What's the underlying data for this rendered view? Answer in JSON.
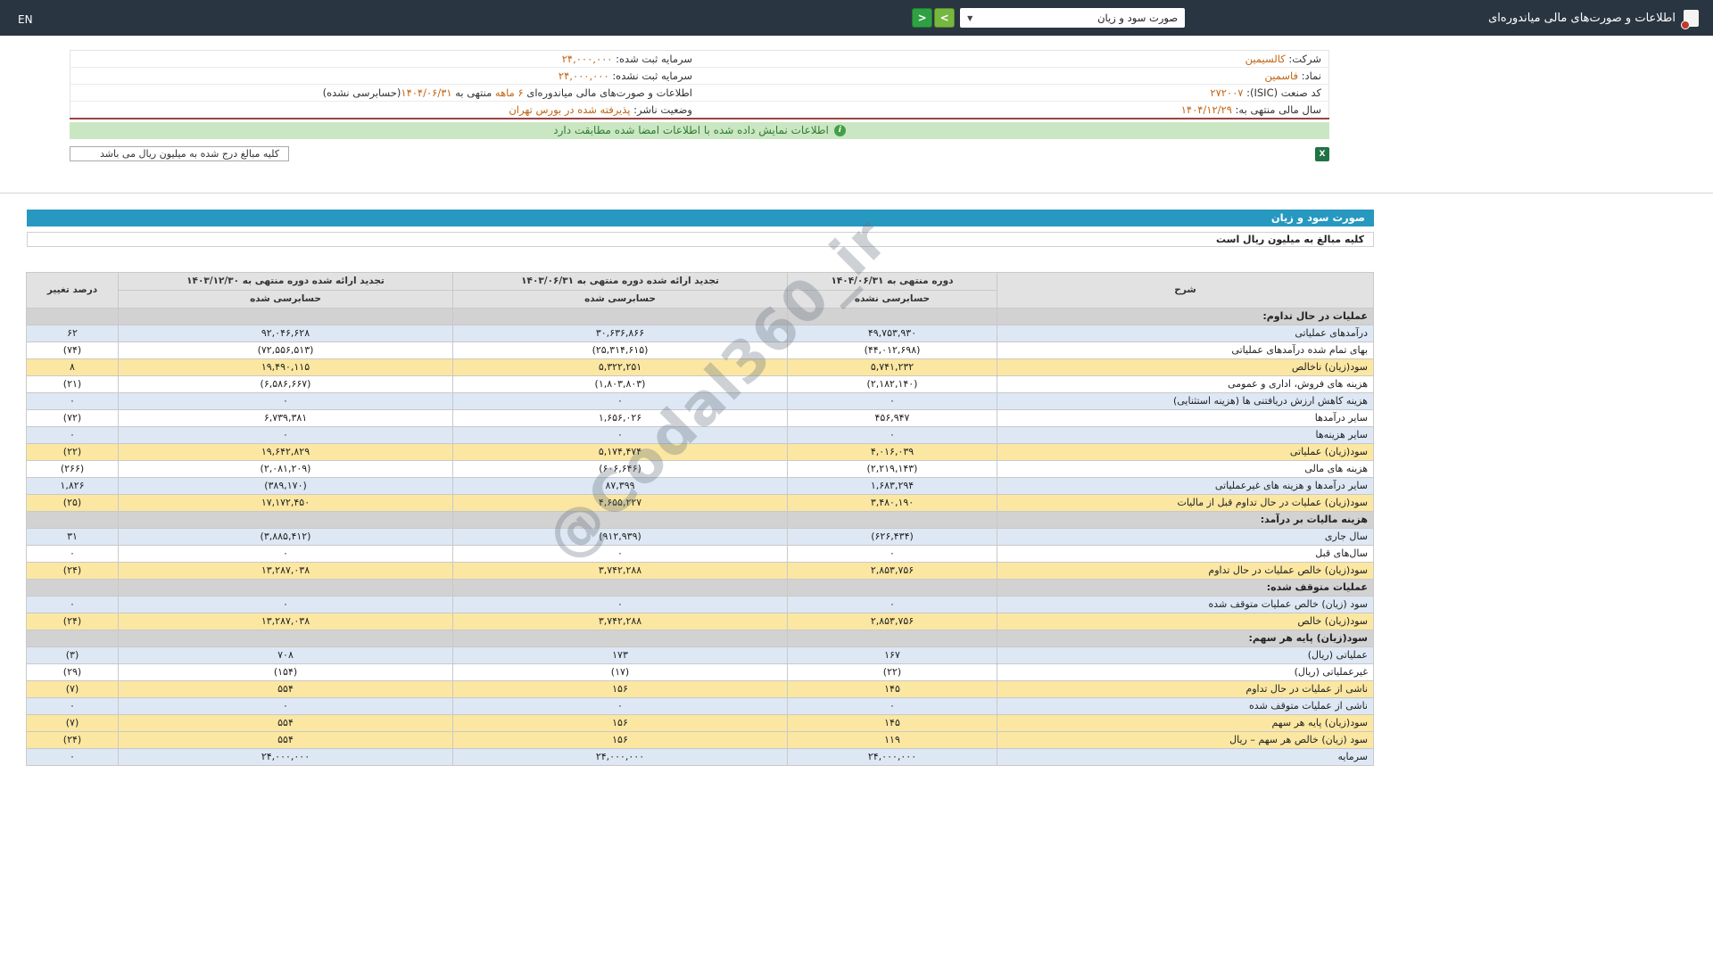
{
  "topbar": {
    "title": "اطلاعات و صورت‌های مالی میاندوره‌ای",
    "dropdown_value": "صورت سود و زیان",
    "prev_label": "<",
    "next_label": ">",
    "lang_toggle": "EN"
  },
  "icons": {
    "caret": "▼",
    "info": "i",
    "excel": "X"
  },
  "company_info": {
    "company_label": "شرکت:",
    "company_value": "کالسیمین",
    "symbol_label": "نماد:",
    "symbol_value": "فاسمین",
    "isic_label": "کد صنعت (ISIC):",
    "isic_value": "۲۷۲۰۰۷",
    "fiscal_year_label": "سال مالی منتهی به:",
    "fiscal_year_value": "۱۴۰۴/۱۲/۲۹",
    "registered_capital_label": "سرمایه ثبت شده:",
    "registered_capital_value": "۲۴,۰۰۰,۰۰۰",
    "unregistered_capital_label": "سرمایه ثبت نشده:",
    "unregistered_capital_value": "۲۴,۰۰۰,۰۰۰",
    "report_line_prefix": "اطلاعات و صورت‌های مالی میاندوره‌ای",
    "report_line_period": "۶ ماهه",
    "report_line_middle": "منتهی به",
    "report_line_date": "۱۴۰۴/۰۶/۳۱",
    "report_line_suffix": "(حسابرسی نشده)",
    "publisher_label": "وضعیت ناشر:",
    "publisher_value": "پذیرفته شده در بورس تهران"
  },
  "notice": "اطلاعات نمایش داده شده با اطلاعات امضا شده مطابقت دارد",
  "amounts_note": "کلیه مبالغ درج شده به میلیون ریال می باشد",
  "watermark": "@Codal360_ir",
  "statement": {
    "title": "صورت سود و زیان",
    "subtitle": "کلیه مبالغ به میلیون ریال است",
    "columns": {
      "desc": "شرح",
      "col1_period": "دوره منتهی به ۱۴۰۴/۰۶/۳۱",
      "col1_audit": "حسابرسی نشده",
      "col2_period": "تجدید ارائه شده دوره منتهی به ۱۴۰۳/۰۶/۳۱",
      "col2_audit": "حسابرسی شده",
      "col3_period": "تجدید ارائه شده دوره منتهی به ۱۴۰۳/۱۲/۳۰",
      "col3_audit": "حسابرسی شده",
      "change": "درصد تغییر"
    },
    "rows": [
      {
        "label": "عملیات در حال تداوم:",
        "v1": "",
        "v2": "",
        "v3": "",
        "change": "",
        "style": "section"
      },
      {
        "label": "درآمدهای عملیاتی",
        "v1": "۴۹,۷۵۳,۹۳۰",
        "v2": "۳۰,۶۳۶,۸۶۶",
        "v3": "۹۲,۰۴۶,۶۲۸",
        "change": "۶۲",
        "style": "blue"
      },
      {
        "label": "بهای تمام شده درآمدهای عملیاتی",
        "v1": "(۴۴,۰۱۲,۶۹۸)",
        "v2": "(۲۵,۳۱۴,۶۱۵)",
        "v3": "(۷۲,۵۵۶,۵۱۳)",
        "change": "(۷۴)",
        "style": "white"
      },
      {
        "label": "سود(زیان) ناخالص",
        "v1": "۵,۷۴۱,۲۳۲",
        "v2": "۵,۳۲۲,۲۵۱",
        "v3": "۱۹,۴۹۰,۱۱۵",
        "change": "۸",
        "style": "yellow"
      },
      {
        "label": "هزینه های فروش، اداری و عمومی",
        "v1": "(۲,۱۸۲,۱۴۰)",
        "v2": "(۱,۸۰۳,۸۰۳)",
        "v3": "(۶,۵۸۶,۶۶۷)",
        "change": "(۲۱)",
        "style": "white"
      },
      {
        "label": "هزینه کاهش ارزش دریافتنی ها (هزینه استثنایی)",
        "v1": "۰",
        "v2": "۰",
        "v3": "۰",
        "change": "۰",
        "style": "blue"
      },
      {
        "label": "سایر درآمدها",
        "v1": "۴۵۶,۹۴۷",
        "v2": "۱,۶۵۶,۰۲۶",
        "v3": "۶,۷۳۹,۳۸۱",
        "change": "(۷۲)",
        "style": "white"
      },
      {
        "label": "سایر هزینه‌ها",
        "v1": "۰",
        "v2": "۰",
        "v3": "۰",
        "change": "۰",
        "style": "blue"
      },
      {
        "label": "سود(زیان) عملیاتی",
        "v1": "۴,۰۱۶,۰۳۹",
        "v2": "۵,۱۷۴,۴۷۴",
        "v3": "۱۹,۶۴۲,۸۲۹",
        "change": "(۲۲)",
        "style": "yellow"
      },
      {
        "label": "هزینه های مالی",
        "v1": "(۲,۲۱۹,۱۴۳)",
        "v2": "(۶۰۶,۶۴۶)",
        "v3": "(۲,۰۸۱,۲۰۹)",
        "change": "(۲۶۶)",
        "style": "white"
      },
      {
        "label": "سایر درآمدها و هزینه های غیرعملیاتی",
        "v1": "۱,۶۸۳,۲۹۴",
        "v2": "۸۷,۳۹۹",
        "v3": "(۳۸۹,۱۷۰)",
        "change": "۱,۸۲۶",
        "style": "blue"
      },
      {
        "label": "سود(زیان) عملیات در حال تداوم قبل از مالیات",
        "v1": "۳,۴۸۰,۱۹۰",
        "v2": "۴,۶۵۵,۲۲۷",
        "v3": "۱۷,۱۷۲,۴۵۰",
        "change": "(۲۵)",
        "style": "yellow"
      },
      {
        "label": "هزینه مالیات بر درآمد:",
        "v1": "",
        "v2": "",
        "v3": "",
        "change": "",
        "style": "section"
      },
      {
        "label": "سال جاری",
        "v1": "(۶۲۶,۴۳۴)",
        "v2": "(۹۱۲,۹۳۹)",
        "v3": "(۳,۸۸۵,۴۱۲)",
        "change": "۳۱",
        "style": "blue"
      },
      {
        "label": "سال‌های قبل",
        "v1": "۰",
        "v2": "۰",
        "v3": "۰",
        "change": "۰",
        "style": "white"
      },
      {
        "label": "سود(زیان) خالص عملیات در حال تداوم",
        "v1": "۲,۸۵۳,۷۵۶",
        "v2": "۳,۷۴۲,۲۸۸",
        "v3": "۱۳,۲۸۷,۰۳۸",
        "change": "(۲۴)",
        "style": "yellow"
      },
      {
        "label": "عملیات متوقف شده:",
        "v1": "",
        "v2": "",
        "v3": "",
        "change": "",
        "style": "section"
      },
      {
        "label": "سود (زیان) خالص عملیات متوقف شده",
        "v1": "۰",
        "v2": "۰",
        "v3": "۰",
        "change": "۰",
        "style": "blue"
      },
      {
        "label": "سود(زیان) خالص",
        "v1": "۲,۸۵۳,۷۵۶",
        "v2": "۳,۷۴۲,۲۸۸",
        "v3": "۱۳,۲۸۷,۰۳۸",
        "change": "(۲۴)",
        "style": "yellow"
      },
      {
        "label": "سود(زیان) پایه هر سهم:",
        "v1": "",
        "v2": "",
        "v3": "",
        "change": "",
        "style": "section"
      },
      {
        "label": "عملیاتی (ریال)",
        "v1": "۱۶۷",
        "v2": "۱۷۳",
        "v3": "۷۰۸",
        "change": "(۳)",
        "style": "blue"
      },
      {
        "label": "غیرعملیاتی (ریال)",
        "v1": "(۲۲)",
        "v2": "(۱۷)",
        "v3": "(۱۵۴)",
        "change": "(۲۹)",
        "style": "white"
      },
      {
        "label": "ناشی از عملیات در حال تداوم",
        "v1": "۱۴۵",
        "v2": "۱۵۶",
        "v3": "۵۵۴",
        "change": "(۷)",
        "style": "yellow"
      },
      {
        "label": "ناشی از عملیات متوقف شده",
        "v1": "۰",
        "v2": "۰",
        "v3": "۰",
        "change": "۰",
        "style": "blue"
      },
      {
        "label": "سود(زیان) پایه هر سهم",
        "v1": "۱۴۵",
        "v2": "۱۵۶",
        "v3": "۵۵۴",
        "change": "(۷)",
        "style": "yellow"
      },
      {
        "label": "سود (زیان) خالص هر سهم – ریال",
        "v1": "۱۱۹",
        "v2": "۱۵۶",
        "v3": "۵۵۴",
        "change": "(۲۴)",
        "style": "yellow"
      },
      {
        "label": "سرمایه",
        "v1": "۲۴,۰۰۰,۰۰۰",
        "v2": "۲۴,۰۰۰,۰۰۰",
        "v3": "۲۴,۰۰۰,۰۰۰",
        "change": "۰",
        "style": "blue"
      }
    ]
  },
  "colors": {
    "topbar_bg": "#293541",
    "accent_blue": "#2798c0",
    "row_blue": "#dde8f4",
    "row_yellow": "#fbe7a1",
    "section_gray": "#d2d2d2",
    "negative_red": "#c00000",
    "value_orange": "#c26414",
    "notice_green_bg": "#cbe6c3",
    "notice_green_text": "#2e7d32",
    "button_green": "#2fa144",
    "excel_green": "#217346",
    "info_border_red": "#9c4343"
  }
}
